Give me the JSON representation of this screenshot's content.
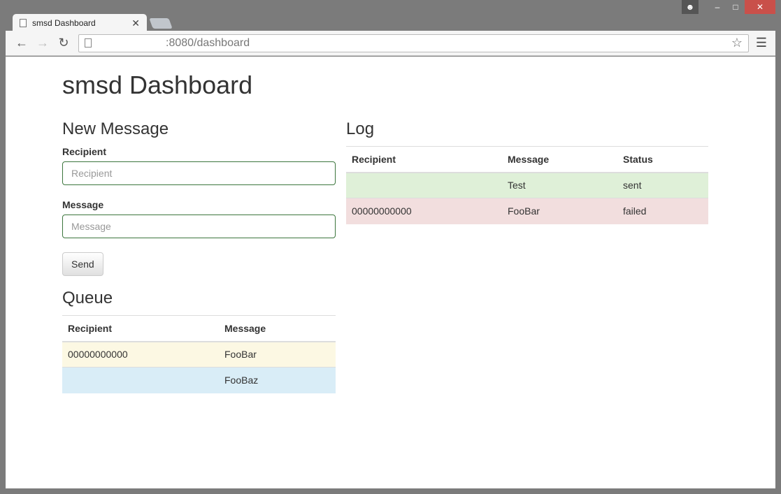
{
  "browser": {
    "tab_title": "smsd Dashboard",
    "url": ":8080/dashboard"
  },
  "page": {
    "title": "smsd Dashboard"
  },
  "new_message": {
    "heading": "New Message",
    "recipient_label": "Recipient",
    "recipient_placeholder": "Recipient",
    "message_label": "Message",
    "message_placeholder": "Message",
    "send_label": "Send"
  },
  "queue": {
    "heading": "Queue",
    "columns": [
      "Recipient",
      "Message"
    ],
    "rows": [
      {
        "recipient": "00000000000",
        "message": "FooBar",
        "state": "warning"
      },
      {
        "recipient": "",
        "message": "FooBaz",
        "state": "info"
      }
    ]
  },
  "log": {
    "heading": "Log",
    "columns": [
      "Recipient",
      "Message",
      "Status"
    ],
    "rows": [
      {
        "recipient": "",
        "message": "Test",
        "status": "sent"
      },
      {
        "recipient": "00000000000",
        "message": "FooBar",
        "status": "failed"
      }
    ]
  }
}
